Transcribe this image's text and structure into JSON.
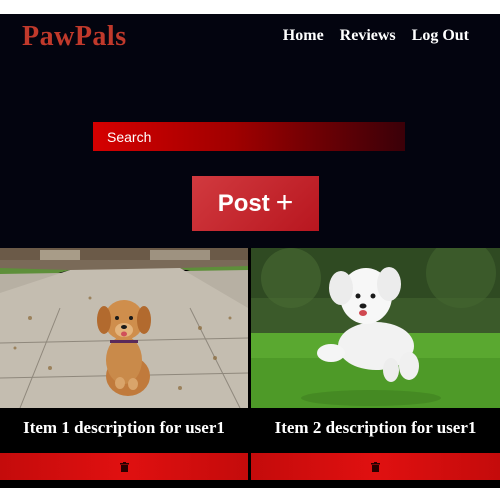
{
  "brand": "PawPals",
  "nav": {
    "home": "Home",
    "reviews": "Reviews",
    "logout": "Log Out"
  },
  "search": {
    "placeholder": "Search"
  },
  "post": {
    "label": "Post",
    "icon": "plus-icon"
  },
  "items": [
    {
      "description": "Item 1 description for user1",
      "image": "golden-retriever-puppy-photo",
      "delete_icon": "trash-icon"
    },
    {
      "description": "Item 2 description for user1",
      "image": "white-fluffy-dog-photo",
      "delete_icon": "trash-icon"
    }
  ],
  "colors": {
    "background": "#03040f",
    "brand": "#c0392b",
    "accent": "#d50000",
    "post_button": "#c82a30"
  }
}
